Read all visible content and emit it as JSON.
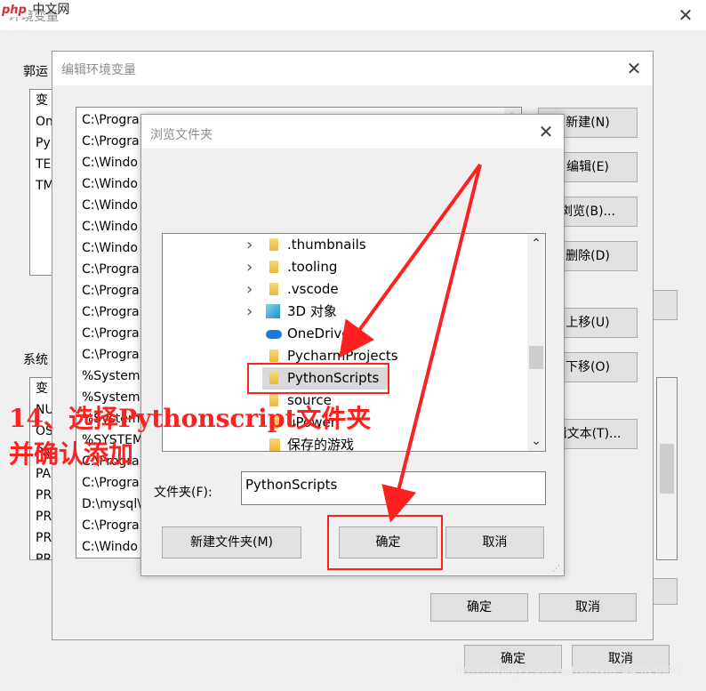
{
  "watermark": {
    "brand": "php",
    "site": "中文网"
  },
  "env_window": {
    "title": "环境变量",
    "user_section_label": "郭运",
    "user_vars": [
      "变",
      "On",
      "Py",
      "TE",
      "TM"
    ],
    "system_section_label": "系统",
    "system_vars": [
      "变",
      "NU",
      "OS",
      "Pa",
      "PA",
      "PR",
      "PR",
      "PR",
      "PR"
    ],
    "ok": "确定",
    "cancel": "取消"
  },
  "edit_window": {
    "title": "编辑环境变量",
    "paths": [
      "C:\\Progra",
      "C:\\Progra",
      "C:\\Windo",
      "C:\\Windo",
      "C:\\Windo",
      "C:\\Windo",
      "C:\\Windo",
      "C:\\Progra",
      "C:\\Progra",
      "C:\\Progra",
      "C:\\Progra",
      "C:\\Progra",
      "%System",
      "%System",
      "%System",
      "%SYSTEM",
      "C:\\Progra",
      "C:\\Progra",
      "D:\\mysql\\",
      "C:\\Progra",
      "C:\\Windo"
    ],
    "buttons": {
      "new": "新建(N)",
      "edit": "编辑(E)",
      "browse": "浏览(B)...",
      "delete": "删除(D)",
      "move_up": "上移(U)",
      "move_down": "下移(O)",
      "edit_text": "辑文本(T)..."
    },
    "ok": "确定",
    "cancel": "取消"
  },
  "browse_dialog": {
    "title": "浏览文件夹",
    "tree": [
      {
        "label": ".thumbnails",
        "icon": "folder-icon",
        "expandable": true
      },
      {
        "label": ".tooling",
        "icon": "folder-icon",
        "expandable": true
      },
      {
        "label": ".vscode",
        "icon": "folder-icon",
        "expandable": true
      },
      {
        "label": "3D 对象",
        "icon": "cube-3d-icon",
        "expandable": true
      },
      {
        "label": "OneDrive",
        "icon": "cloud-icon",
        "expandable": false
      },
      {
        "label": "PycharmProjects",
        "icon": "folder-icon",
        "expandable": false
      },
      {
        "label": "PythonScripts",
        "icon": "folder-icon",
        "expandable": false,
        "selected": true
      },
      {
        "label": "source",
        "icon": "folder-icon",
        "expandable": false
      },
      {
        "label": "uPower",
        "icon": "folder-icon",
        "expandable": false
      },
      {
        "label": "保存的游戏",
        "icon": "saved-games-icon",
        "expandable": false
      }
    ],
    "folder_label": "文件夹(F):",
    "folder_value": "PythonScripts",
    "new_folder": "新建文件夹(M)",
    "ok": "确定",
    "cancel": "取消"
  },
  "annotation": {
    "line1": "14、选择Pythonscript文件夹",
    "line2": "并确认添加",
    "color": "#ff2020"
  },
  "footer_watermark": "https://blog.csdn.net/weixin_44963880"
}
